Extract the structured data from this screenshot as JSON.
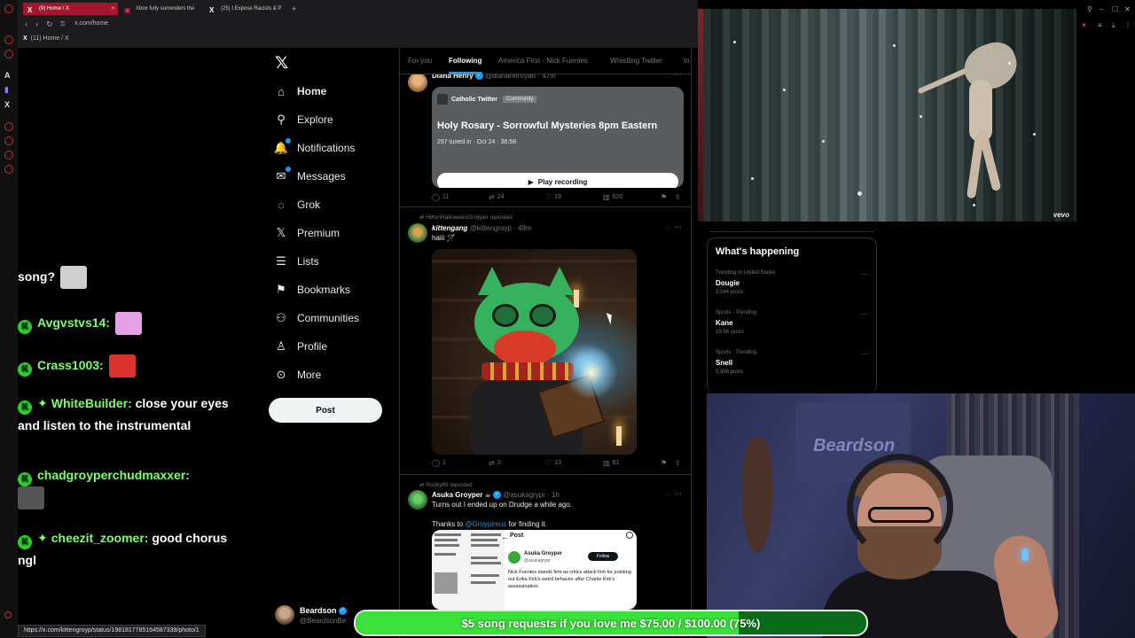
{
  "browser": {
    "tabs": [
      {
        "label": "(9) Home / X",
        "favicon": "X"
      },
      {
        "label": "Xbox fully surrenders the",
        "favicon": "X"
      },
      {
        "label": "(25) I Expose Racists & P",
        "favicon": "X"
      }
    ],
    "new_tab": "+",
    "url": "x.com/home",
    "bookmark": "(11) Home / X",
    "status_url": "https://x.com/kittengroyp/status/1981817785164587339/photo/1"
  },
  "x_nav": {
    "logo": "𝕏",
    "items": [
      {
        "label": "Home",
        "icon": "home-icon",
        "glyph": "⌂"
      },
      {
        "label": "Explore",
        "icon": "search-icon",
        "glyph": "⚲"
      },
      {
        "label": "Notifications",
        "icon": "bell-icon",
        "glyph": "🔔"
      },
      {
        "label": "Messages",
        "icon": "envelope-icon",
        "glyph": "✉"
      },
      {
        "label": "Grok",
        "icon": "grok-icon",
        "glyph": "◌"
      },
      {
        "label": "Premium",
        "icon": "x-premium-icon",
        "glyph": "𝕏"
      },
      {
        "label": "Lists",
        "icon": "list-icon",
        "glyph": "☰"
      },
      {
        "label": "Bookmarks",
        "icon": "bookmark-icon",
        "glyph": "⚑"
      },
      {
        "label": "Communities",
        "icon": "people-icon",
        "glyph": "⚇"
      },
      {
        "label": "Profile",
        "icon": "person-icon",
        "glyph": "♙"
      },
      {
        "label": "More",
        "icon": "more-circle-icon",
        "glyph": "⊙"
      }
    ],
    "post_label": "Post",
    "account": {
      "name": "Beardson",
      "handle": "@BeardsonBe"
    }
  },
  "timeline": {
    "tabs": [
      "For you",
      "Following",
      "America First - Nick Fuentes",
      "Wrestling Twitter",
      "In"
    ],
    "active_tab": "Following",
    "tweets": [
      {
        "name": "Diana Henry",
        "handle": "@dianahenryart",
        "time": "47m",
        "space": {
          "community": "Catholic Twitter",
          "badge": "Community",
          "title": "Holy Rosary - Sorrowful Mysteries 8pm Eastern",
          "meta": "297 tuned in · Oct 24 · 36:58",
          "play_label": "Play recording"
        },
        "actions": {
          "replies": "11",
          "reposts": "24",
          "likes": "19",
          "views": "620"
        }
      },
      {
        "repost_by": "HiltonHalloweenGroyper reposted",
        "name": "kittengang",
        "handle": "@kittengroyp",
        "time": "49m",
        "text": "haiii 🪄",
        "actions": {
          "replies": "1",
          "reposts": "3",
          "likes": "13",
          "views": "81"
        }
      },
      {
        "repost_by": "Rocky69 reposted",
        "name": "Asuka Groyper ☕",
        "handle": "@asukagrypr",
        "time": "1h",
        "text": "Turns out I ended up on Drudge a while ago.",
        "thanks_pre": "Thanks to ",
        "thanks_link": "@Groypimus",
        "thanks_post": " for finding it.",
        "embed": {
          "header": "Post",
          "name": "Asuka Groyper",
          "handle": "@asukagrypr",
          "follow": "Follow",
          "text": "Nick Fuentes stands firm as critics attack him for pointing out Erika Kirk's weird behavior after Charlie Kirk's assassination."
        }
      }
    ]
  },
  "trends": {
    "title": "What's happening",
    "items": [
      {
        "category": "Trending in United States",
        "name": "Dougie",
        "count": "3,044 posts"
      },
      {
        "category": "Sports · Trending",
        "name": "Kane",
        "count": "19.5K posts"
      },
      {
        "category": "Sports · Trending",
        "name": "Snell",
        "count": "5,998 posts"
      }
    ]
  },
  "video": {
    "watermark": "vevo"
  },
  "webcam": {
    "poster_text": "Beardson"
  },
  "chat": {
    "messages": [
      {
        "user": "",
        "text": "song?",
        "emote": true,
        "emote_color": "#cfcfcf"
      },
      {
        "user": "Avgvstvs14:",
        "text": "",
        "emote": true,
        "emote_color": "#e6a0e6"
      },
      {
        "user": "Crass1003:",
        "text": "",
        "emote": true,
        "emote_color": "#d9332b"
      },
      {
        "user": "WhiteBuilder:",
        "text": "close your eyes and listen to the instrumental",
        "star": true
      },
      {
        "user": "chadgroyperchudmaxxer:",
        "text": "",
        "emote": true,
        "emote_color": "#555555"
      },
      {
        "user": "cheezit_zoomer:",
        "text": "good chorus ngl",
        "star": true
      }
    ]
  },
  "goal": {
    "text": "$5 song requests if you love me $75.00 / $100.00 (75%)",
    "fraction": 0.75
  }
}
